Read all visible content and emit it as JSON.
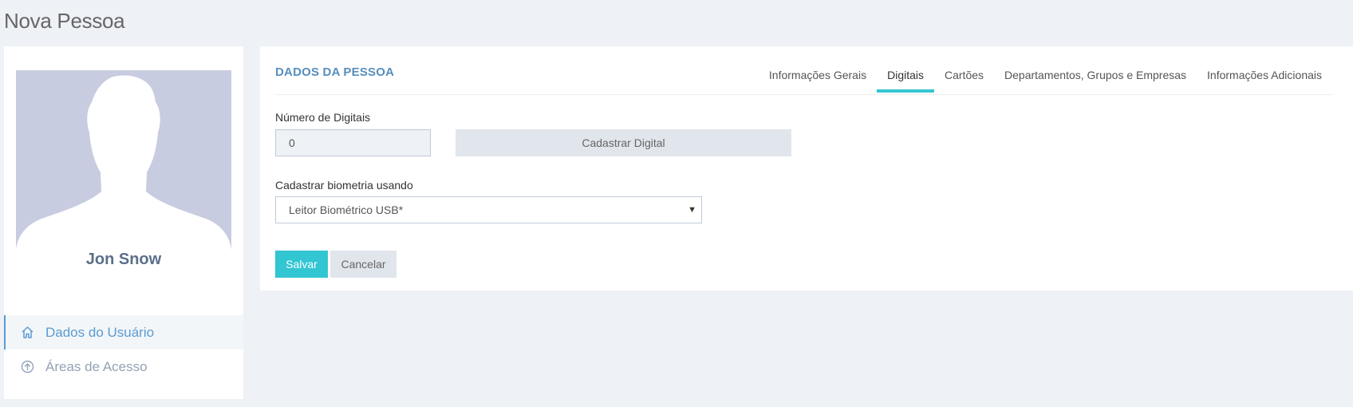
{
  "page": {
    "title": "Nova Pessoa"
  },
  "profile": {
    "name": "Jon Snow",
    "menu": [
      {
        "label": "Dados do Usuário",
        "icon": "home-icon",
        "active": true
      },
      {
        "label": "Áreas de Acesso",
        "icon": "arrow-up-circle-icon",
        "active": false
      }
    ]
  },
  "main": {
    "title": "DADOS DA PESSOA",
    "tabs": [
      {
        "label": "Informações Gerais",
        "active": false
      },
      {
        "label": "Digitais",
        "active": true
      },
      {
        "label": "Cartões",
        "active": false
      },
      {
        "label": "Departamentos, Grupos e Empresas",
        "active": false
      },
      {
        "label": "Informações Adicionais",
        "active": false
      }
    ],
    "digit_count_label": "Número de Digitais",
    "digit_count_value": "0",
    "register_button": "Cadastrar Digital",
    "biometry_label": "Cadastrar biometria usando",
    "biometry_selected": "Leitor Biométrico USB*",
    "save_button": "Salvar",
    "cancel_button": "Cancelar"
  },
  "colors": {
    "background": "#eef1f5",
    "accent": "#36c6d3",
    "title_blue": "#578ebe",
    "avatar_bg": "#c8cce0"
  }
}
